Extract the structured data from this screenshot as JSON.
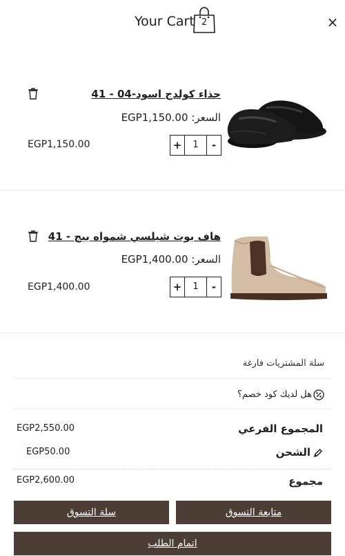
{
  "header": {
    "title": "Your Cart",
    "cart_count": "2",
    "close_label": "×"
  },
  "items": [
    {
      "name": "حذاء كولدج اسود-04 - 41",
      "price_label": "السعر:",
      "price": "EGP1,150.00",
      "quantity": "1",
      "total": "EGP1,150.00",
      "minus": "-",
      "plus": "+"
    },
    {
      "name": "هاف بوت شيلسي شمواه بيج - 41",
      "price_label": "السعر:",
      "price": "EGP1,400.00",
      "quantity": "1",
      "total": "EGP1,400.00",
      "minus": "-",
      "plus": "+"
    }
  ],
  "summary": {
    "empty_note": "سلة المشتريات فارغة",
    "coupon_text": "هل لديك كود خصم؟",
    "subtotal_label": "المجموع الفرعي",
    "subtotal_value": "EGP2,550.00",
    "shipping_label": "الشحن",
    "shipping_value": "EGP50.00",
    "total_label": "مجموع",
    "total_value": "EGP2,600.00"
  },
  "buttons": {
    "continue_shopping": "متابعة التسوق",
    "view_cart": "سلة التسوق",
    "checkout": "اتمام الطلب"
  },
  "colors": {
    "button_bg": "#4c3e34",
    "text": "#1f1f1f"
  },
  "icons": [
    "shopping-bag-icon",
    "close-icon",
    "trash-icon",
    "discount-icon",
    "pencil-icon"
  ]
}
